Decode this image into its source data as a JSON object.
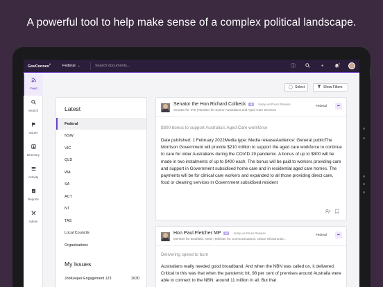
{
  "headline": "A powerful tool to help make sense of a complex political landscape.",
  "colors": {
    "background": "#3b2a40",
    "accent": "#6c3fc2",
    "topbar": "#2b1e3a"
  },
  "topbar": {
    "brand": "GovConnex",
    "brand_mark": "®",
    "region": "Federal",
    "search_placeholder": "Search documents..."
  },
  "sidebar": {
    "items": [
      {
        "label": "Feed",
        "icon": "rss-icon"
      },
      {
        "label": "Search",
        "icon": "search-icon"
      },
      {
        "label": "Issues",
        "icon": "flag-icon"
      },
      {
        "label": "Directory",
        "icon": "contact-card-icon"
      },
      {
        "label": "Activity",
        "icon": "list-icon"
      },
      {
        "label": "Reports",
        "icon": "report-icon"
      },
      {
        "label": "Admin",
        "icon": "tools-icon"
      }
    ]
  },
  "toolbar": {
    "select_label": "Select",
    "filters_label": "Show Filters"
  },
  "left_panel": {
    "latest_title": "Latest",
    "latest_items": [
      "Federal",
      "NSW",
      "VIC",
      "QLD",
      "WA",
      "SA",
      "ACT",
      "NT",
      "TAS",
      "Local Councils",
      "Organisations"
    ],
    "issues_title": "My Issues",
    "issues": [
      {
        "name": "JobKeeper Engagement 123",
        "count": "2630"
      }
    ]
  },
  "cards": [
    {
      "name": "Senator the Hon Richard Colbeck",
      "badge": "LP",
      "meta": "· today via Press Release",
      "role": "Senator for TAS | Minister for Senior Australians and Aged Care Services",
      "region": "Federal",
      "subject": "$800 bonus to support Australia's Aged Care workforce",
      "body": "Date published: 1 February 2022Media type: Media releaseAudience: General publicThe Morrison Government will provide $210 million to support the aged care workforce to continue to care for older Australians during the COVID 19 pandemic. A bonus of up to $800 will be made in two instalments of up to $400 each. The bonus will be paid to workers providing care and support in Government subsidised home care and in residential aged care homes. The payments will be for clinical care workers and expanded to all those providing direct care, food or cleaning services in Government subsidised resident"
    },
    {
      "name": "Hon Paul Fletcher MP",
      "badge": "LP",
      "meta": "· today via Press Release",
      "role": "Member for Bradfield, NSW | Minister for Communications, Urban Infrastructur...",
      "region": "Federal",
      "subject": "Delivering speed to burn",
      "body": "Australians really needed good broadband. And when the NBN was called on, it delivered. Critical to this was that when the pandemic hit, 98 per cent of premises around Australia were able to connect to the NBN: around 11 million in all. But that"
    }
  ]
}
